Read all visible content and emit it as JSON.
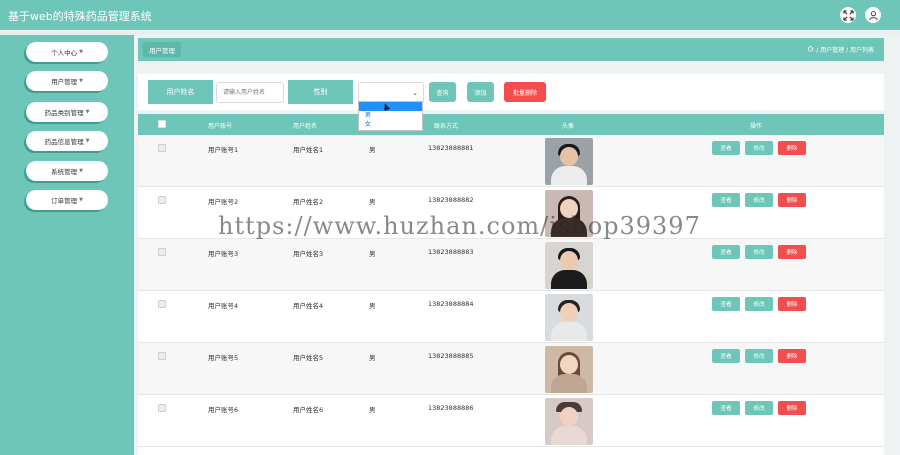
{
  "app": {
    "title": "基于web的特殊药品管理系统"
  },
  "header_icons": [
    "fullscreen-icon",
    "user-icon"
  ],
  "sidebar": {
    "items": [
      {
        "label": "个人中心"
      },
      {
        "label": "用户管理"
      },
      {
        "label": "药品类别管理"
      },
      {
        "label": "药品信息管理"
      },
      {
        "label": "系统管理"
      },
      {
        "label": "订单管理"
      }
    ]
  },
  "breadcrumb": {
    "tab": "用户管理",
    "path": "/ 用户管理 / 用户列表"
  },
  "search": {
    "name_label": "用户姓名",
    "name_placeholder": "请输入用户姓名",
    "gender_label": "性别",
    "gender_value": "",
    "query_button": "查询",
    "add_button": "添加",
    "batch_delete_button": "批量删除"
  },
  "gender_dropdown": {
    "options": [
      "",
      "男",
      "女"
    ]
  },
  "table": {
    "columns": [
      "用户账号",
      "用户姓名",
      "性别",
      "联系方式",
      "头像",
      "操作"
    ],
    "rows": [
      {
        "account": "用户账号1",
        "name": "用户姓名1",
        "gender": "男",
        "phone": "13823888881"
      },
      {
        "account": "用户账号2",
        "name": "用户姓名2",
        "gender": "男",
        "phone": "13823888882"
      },
      {
        "account": "用户账号3",
        "name": "用户姓名3",
        "gender": "男",
        "phone": "13823888883"
      },
      {
        "account": "用户账号4",
        "name": "用户姓名4",
        "gender": "男",
        "phone": "13823888884"
      },
      {
        "account": "用户账号5",
        "name": "用户姓名5",
        "gender": "男",
        "phone": "13823888885"
      },
      {
        "account": "用户账号6",
        "name": "用户姓名6",
        "gender": "男",
        "phone": "13823888886"
      }
    ],
    "row_actions": {
      "view": "查看",
      "edit": "修改",
      "delete": "删除"
    }
  },
  "watermark": "https://www.huzhan.com/ishop39397",
  "colors": {
    "accent": "#6ec6b8",
    "danger": "#f34d4d",
    "link": "#1e90ff"
  }
}
